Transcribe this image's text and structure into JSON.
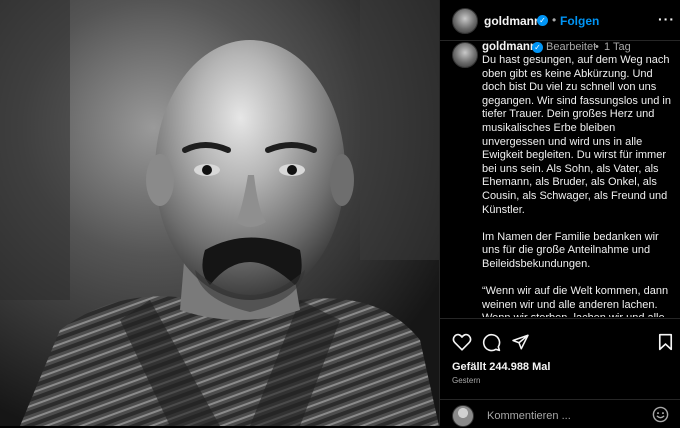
{
  "header": {
    "username": "goldmann",
    "separator": "•",
    "follow_label": "Folgen",
    "more_label": "···"
  },
  "caption": {
    "username": "goldmann",
    "edited_label": "Bearbeitet",
    "separator": "•",
    "age": "1 Tag",
    "text": "Du hast gesungen, auf dem Weg nach oben gibt es keine Abkürzung. Und doch bist Du viel zu schnell von uns gegangen. Wir sind fassungslos und in tiefer Trauer. Dein großes Herz und musikalisches Erbe bleiben unvergessen und wird uns in alle Ewigkeit begleiten. Du wirst für immer bei uns sein. Als Sohn, als Vater, als Ehemann, als Bruder, als Onkel, als Cousin, als Schwager, als Freund und Künstler.\n\nIm Namen der Familie bedanken wir uns für die große Anteilnahme und Beileidsbekundungen.\n\n“Wenn wir auf die Welt kommen, dann weinen wir und alle anderen lachen. Wenn wir sterben, lachen wir und alle anderen weinen.”"
  },
  "actions": {
    "like_icon": "heart-icon",
    "comment_icon": "comment-icon",
    "share_icon": "paper-plane-icon",
    "save_icon": "bookmark-icon",
    "likes_text": "Gefällt 244.988 Mal",
    "time_text": "Gestern"
  },
  "comment": {
    "placeholder": "Kommentieren ...",
    "emoji_icon": "smiley-icon"
  },
  "colors": {
    "accent": "#0095f6",
    "background": "#000000",
    "muted": "#a8a8a8"
  }
}
